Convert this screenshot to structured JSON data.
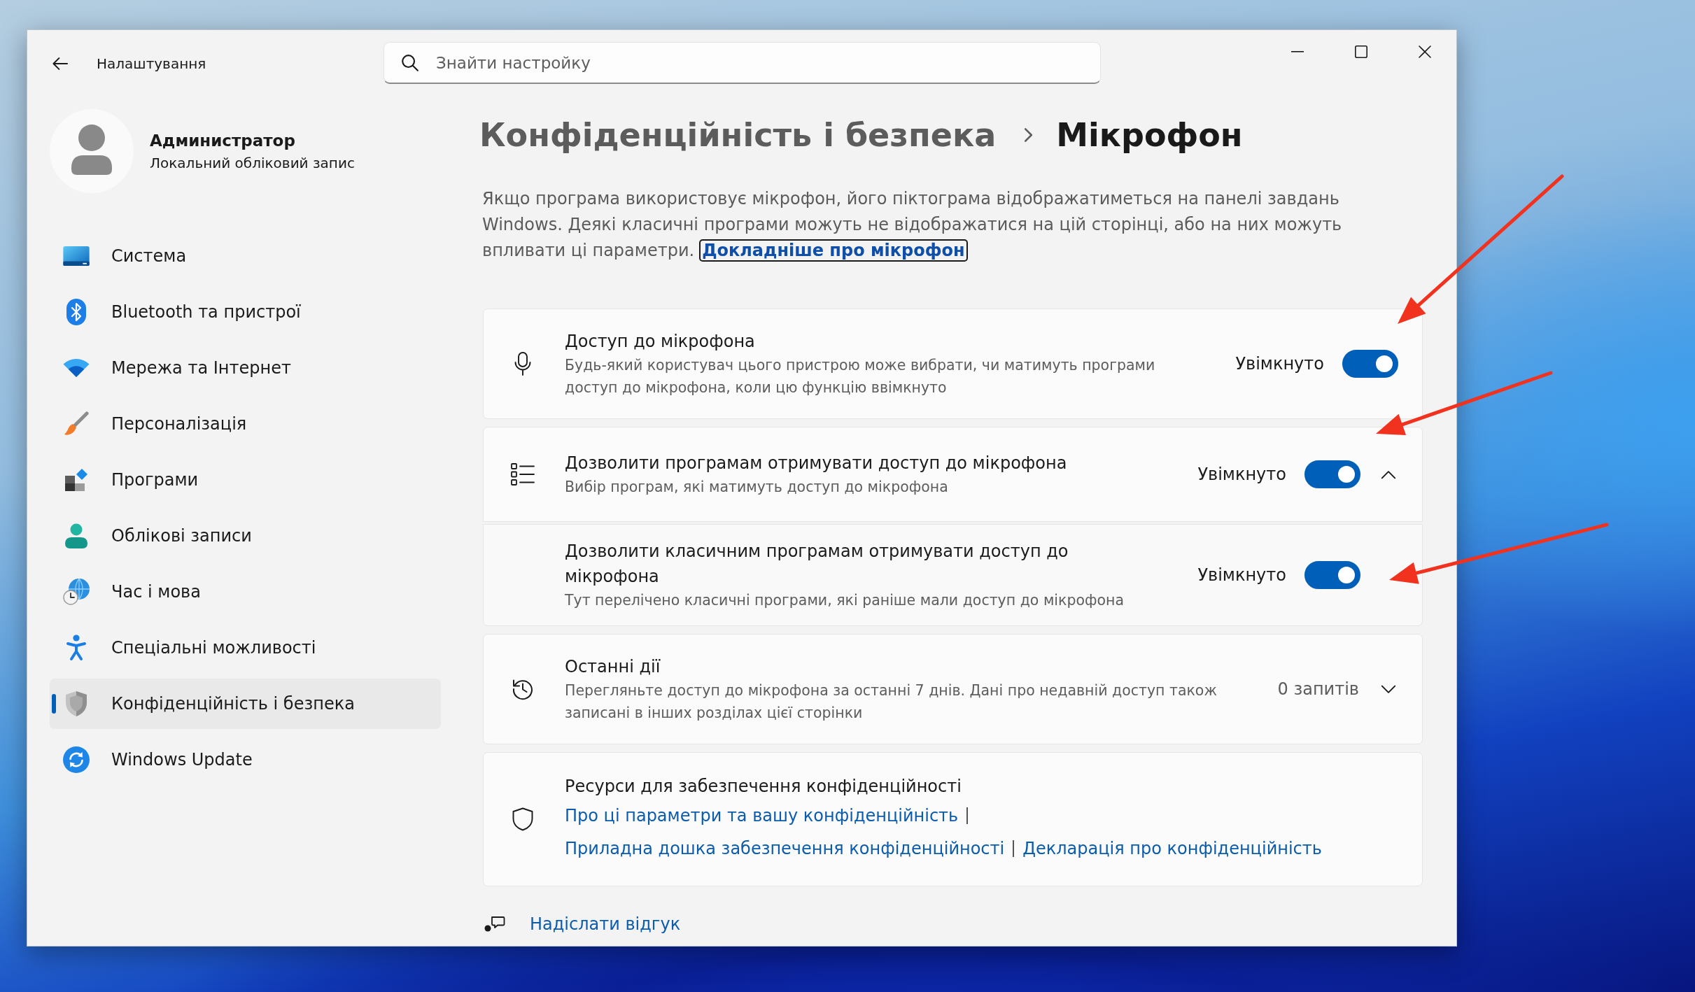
{
  "window": {
    "title": "Налаштування",
    "search": {
      "placeholder": "Знайти настройку"
    }
  },
  "account": {
    "name": "Администратор",
    "type": "Локальний обліковий запис"
  },
  "sidebar": {
    "items": [
      {
        "label": "Система",
        "selected": false
      },
      {
        "label": "Bluetooth та пристрої",
        "selected": false
      },
      {
        "label": "Мережа та Інтернет",
        "selected": false
      },
      {
        "label": "Персоналізація",
        "selected": false
      },
      {
        "label": "Програми",
        "selected": false
      },
      {
        "label": "Облікові записи",
        "selected": false
      },
      {
        "label": "Час і мова",
        "selected": false
      },
      {
        "label": "Спеціальні можливості",
        "selected": false
      },
      {
        "label": "Конфіденційність і безпека",
        "selected": true
      },
      {
        "label": "Windows Update",
        "selected": false
      }
    ]
  },
  "page": {
    "parent": "Конфіденційність і безпека",
    "title": "Мікрофон"
  },
  "description": {
    "text": "Якщо програма використовує мікрофон, його піктограма відображатиметься на панелі завдань Windows. Деякі класичні програми можуть не відображатися на цій сторінці, або на них можуть впливати ці параметри.",
    "link": "Докладніше про мікрофон",
    "link_focused": true
  },
  "cards": [
    {
      "kind": "toggle",
      "title": "Доступ до мікрофона",
      "description": "Будь-який користувач цього пристрою може вибрати, чи матимуть програми доступ до мікрофона, коли цю функцію ввімкнуто",
      "status": "Увімкнуто",
      "on": true
    },
    {
      "kind": "expander",
      "title": "Дозволити програмам отримувати доступ до мікрофона",
      "description": "Вибір програм, які матимуть доступ до мікрофона",
      "status": "Увімкнуто",
      "on": true,
      "expanded": true
    },
    {
      "kind": "sub",
      "title": "Дозволити класичним програмам отримувати доступ до мікрофона",
      "description": "Тут перелічено класичні програми, які раніше мали доступ до мікрофона",
      "status": "Увімкнуто",
      "on": true
    },
    {
      "kind": "activity",
      "title": "Останні дії",
      "description": "Перегляньте доступ до мікрофона за останні 7 днів. Дані про недавній доступ також записані в інших розділах цієї сторінки",
      "count": "0 запитів",
      "expanded": false
    },
    {
      "kind": "links",
      "title": "Ресурси для забезпечення конфіденційності",
      "link_rows": [
        [
          "Про ці параметри та вашу конфіденційність"
        ],
        [
          "Приладна дошка забезпечення конфіденційності",
          "Декларація про конфіденційність"
        ]
      ]
    }
  ],
  "feedback": {
    "label": "Надіслати відгук"
  }
}
